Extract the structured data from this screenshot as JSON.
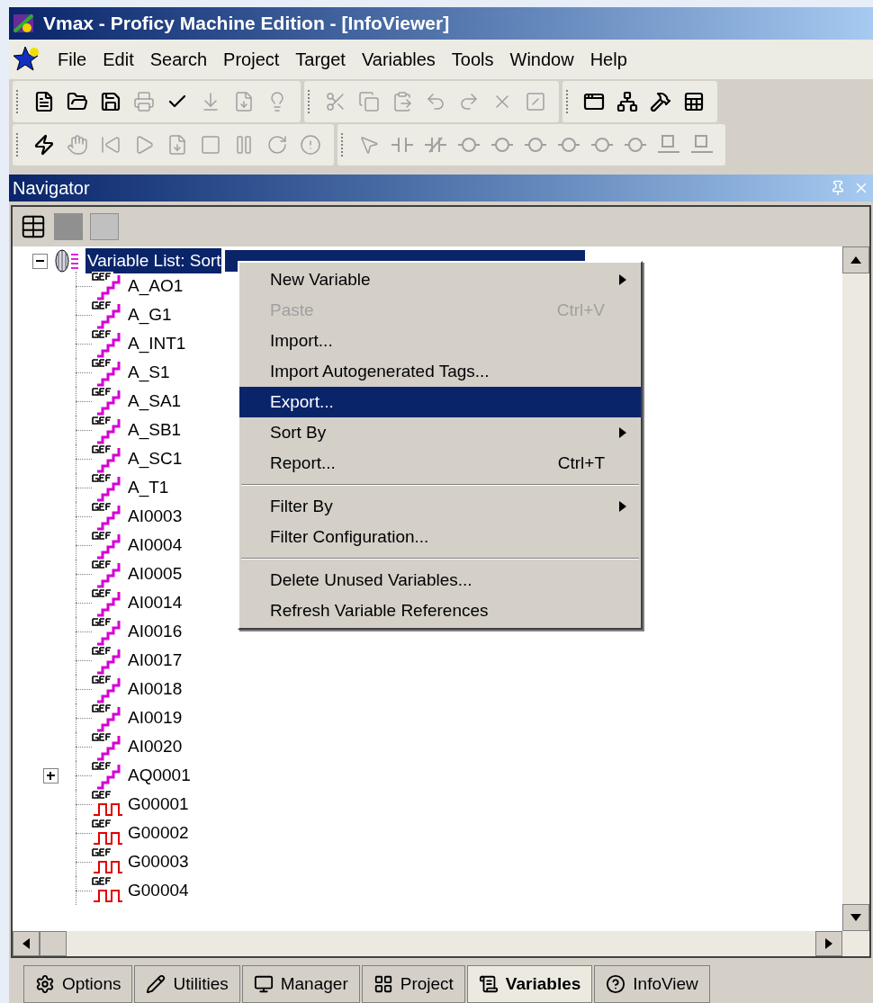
{
  "window": {
    "title": "Vmax - Proficy Machine Edition - [InfoViewer]"
  },
  "menu_bar": [
    "File",
    "Edit",
    "Search",
    "Project",
    "Target",
    "Variables",
    "Tools",
    "Window",
    "Help"
  ],
  "toolbars": [
    [
      {
        "kind": "new",
        "disabled": false
      },
      {
        "kind": "open",
        "disabled": false
      },
      {
        "kind": "save",
        "disabled": false
      },
      {
        "kind": "print",
        "disabled": true
      },
      {
        "kind": "validate",
        "disabled": false
      },
      {
        "kind": "download",
        "disabled": true
      },
      {
        "kind": "download-run",
        "disabled": true
      },
      {
        "kind": "bulb",
        "disabled": true
      },
      {
        "kind": "sep"
      },
      {
        "kind": "cut",
        "disabled": true
      },
      {
        "kind": "copy",
        "disabled": true
      },
      {
        "kind": "paste",
        "disabled": true
      },
      {
        "kind": "undo",
        "disabled": true
      },
      {
        "kind": "redo",
        "disabled": true
      },
      {
        "kind": "delete",
        "disabled": true
      },
      {
        "kind": "properties",
        "disabled": true
      },
      {
        "kind": "sep"
      },
      {
        "kind": "window",
        "disabled": false
      },
      {
        "kind": "network",
        "disabled": false
      },
      {
        "kind": "build",
        "disabled": false
      },
      {
        "kind": "sheet",
        "disabled": false
      }
    ],
    [
      {
        "kind": "lightning",
        "disabled": false
      },
      {
        "kind": "hand",
        "disabled": true
      },
      {
        "kind": "rewind",
        "disabled": true
      },
      {
        "kind": "play",
        "disabled": true
      },
      {
        "kind": "download-run",
        "disabled": true
      },
      {
        "kind": "stop",
        "disabled": true
      },
      {
        "kind": "pause",
        "disabled": true
      },
      {
        "kind": "refresh",
        "disabled": true
      },
      {
        "kind": "alert",
        "disabled": true
      },
      {
        "kind": "sep"
      },
      {
        "kind": "pointer",
        "disabled": true
      },
      {
        "kind": "contact",
        "disabled": true
      },
      {
        "kind": "nc-contact",
        "disabled": true
      },
      {
        "kind": "coil",
        "disabled": true
      },
      {
        "kind": "coil",
        "disabled": true
      },
      {
        "kind": "coil",
        "disabled": true
      },
      {
        "kind": "coil",
        "disabled": true
      },
      {
        "kind": "coil",
        "disabled": true
      },
      {
        "kind": "coil",
        "disabled": true
      },
      {
        "kind": "block",
        "disabled": true
      },
      {
        "kind": "block",
        "disabled": true
      }
    ]
  ],
  "navigator": {
    "title": "Navigator",
    "tree": {
      "label": "Variable List: Sort",
      "selected": true,
      "expanded": true,
      "children": [
        {
          "label": "A_AO1",
          "kind": "analog",
          "collapsed": false
        },
        {
          "label": "A_G1",
          "kind": "analog",
          "collapsed": false
        },
        {
          "label": "A_INT1",
          "kind": "analog",
          "collapsed": false
        },
        {
          "label": "A_S1",
          "kind": "analog",
          "collapsed": false
        },
        {
          "label": "A_SA1",
          "kind": "analog",
          "collapsed": false
        },
        {
          "label": "A_SB1",
          "kind": "analog",
          "collapsed": false
        },
        {
          "label": "A_SC1",
          "kind": "analog",
          "collapsed": false
        },
        {
          "label": "A_T1",
          "kind": "analog",
          "collapsed": false
        },
        {
          "label": "AI0003",
          "kind": "analog",
          "collapsed": false
        },
        {
          "label": "AI0004",
          "kind": "analog",
          "collapsed": false
        },
        {
          "label": "AI0005",
          "kind": "analog",
          "collapsed": false
        },
        {
          "label": "AI0014",
          "kind": "analog",
          "collapsed": false
        },
        {
          "label": "AI0016",
          "kind": "analog",
          "collapsed": false
        },
        {
          "label": "AI0017",
          "kind": "analog",
          "collapsed": false
        },
        {
          "label": "AI0018",
          "kind": "analog",
          "collapsed": false
        },
        {
          "label": "AI0019",
          "kind": "analog",
          "collapsed": false
        },
        {
          "label": "AI0020",
          "kind": "analog",
          "collapsed": false
        },
        {
          "label": "AQ0001",
          "kind": "analog",
          "collapsed": true
        },
        {
          "label": "G00001",
          "kind": "discrete",
          "collapsed": false
        },
        {
          "label": "G00002",
          "kind": "discrete",
          "collapsed": false
        },
        {
          "label": "G00003",
          "kind": "discrete",
          "collapsed": false
        },
        {
          "label": "G00004",
          "kind": "discrete",
          "collapsed": false
        }
      ]
    }
  },
  "context_menu": [
    {
      "kind": "item",
      "label": "New Variable",
      "submenu": true,
      "disabled": false,
      "selected": false
    },
    {
      "kind": "item",
      "label": "Paste",
      "shortcut": "Ctrl+V",
      "submenu": false,
      "disabled": true,
      "selected": false
    },
    {
      "kind": "item",
      "label": "Import...",
      "submenu": false,
      "disabled": false,
      "selected": false
    },
    {
      "kind": "item",
      "label": "Import Autogenerated Tags...",
      "submenu": false,
      "disabled": false,
      "selected": false
    },
    {
      "kind": "item",
      "label": "Export...",
      "submenu": false,
      "disabled": false,
      "selected": true
    },
    {
      "kind": "item",
      "label": "Sort By",
      "submenu": true,
      "disabled": false,
      "selected": false
    },
    {
      "kind": "item",
      "label": "Report...",
      "shortcut": "Ctrl+T",
      "submenu": false,
      "disabled": false,
      "selected": false
    },
    {
      "kind": "separator"
    },
    {
      "kind": "item",
      "label": "Filter By",
      "submenu": true,
      "disabled": false,
      "selected": false
    },
    {
      "kind": "item",
      "label": "Filter Configuration...",
      "submenu": false,
      "disabled": false,
      "selected": false
    },
    {
      "kind": "separator"
    },
    {
      "kind": "item",
      "label": "Delete Unused Variables...",
      "submenu": false,
      "disabled": false,
      "selected": false
    },
    {
      "kind": "item",
      "label": "Refresh Variable References",
      "submenu": false,
      "disabled": false,
      "selected": false
    }
  ],
  "bottom_tabs": [
    {
      "label": "Options",
      "selected": false
    },
    {
      "label": "Utilities",
      "selected": false
    },
    {
      "label": "Manager",
      "selected": false
    },
    {
      "label": "Project",
      "selected": false
    },
    {
      "label": "Variables",
      "selected": true
    },
    {
      "label": "InfoView",
      "selected": false
    }
  ]
}
